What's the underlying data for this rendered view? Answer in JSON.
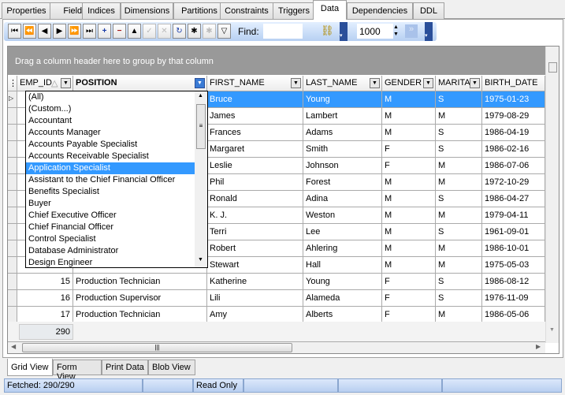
{
  "tabs": [
    "Properties",
    "Fields",
    "Indices",
    "Dimensions",
    "Partitions",
    "Constraints",
    "Triggers",
    "Data",
    "Dependencies",
    "DDL"
  ],
  "active_tab": "Data",
  "toolbar": {
    "find_label": "Find:",
    "find_value": "",
    "record_limit": "1000"
  },
  "group_panel": "Drag a column header here to group by that column",
  "columns": [
    "EMP_ID",
    "POSITION",
    "FIRST_NAME",
    "LAST_NAME",
    "GENDER",
    "MARITAL_STATUS",
    "BIRTH_DATE"
  ],
  "column_headers_shown": [
    "EMP_ID",
    "POSITION",
    "FIRST_NAME",
    "LAST_NAME",
    "GENDER",
    "MARITA",
    "BIRTH_DATE"
  ],
  "rows": [
    [
      "",
      "",
      "Bruce",
      "Young",
      "M",
      "S",
      "1975-01-23"
    ],
    [
      "",
      "",
      "James",
      "Lambert",
      "M",
      "M",
      "1979-08-29"
    ],
    [
      "",
      "",
      "Frances",
      "Adams",
      "M",
      "S",
      "1986-04-19"
    ],
    [
      "",
      "",
      "Margaret",
      "Smith",
      "F",
      "S",
      "1986-02-16"
    ],
    [
      "",
      "",
      "Leslie",
      "Johnson",
      "F",
      "M",
      "1986-07-06"
    ],
    [
      "",
      "",
      "Phil",
      "Forest",
      "M",
      "M",
      "1972-10-29"
    ],
    [
      "",
      "",
      "Ronald",
      "Adina",
      "M",
      "S",
      "1986-04-27"
    ],
    [
      "",
      "",
      "K. J.",
      "Weston",
      "M",
      "M",
      "1979-04-11"
    ],
    [
      "",
      "",
      "Terri",
      "Lee",
      "M",
      "S",
      "1961-09-01"
    ],
    [
      "",
      "",
      "Robert",
      "Ahlering",
      "M",
      "M",
      "1986-10-01"
    ],
    [
      "",
      "",
      "Stewart",
      "Hall",
      "M",
      "M",
      "1975-05-03"
    ],
    [
      "15",
      "Production Technician",
      "Katherine",
      "Young",
      "F",
      "S",
      "1986-08-12"
    ],
    [
      "16",
      "Production Supervisor",
      "Lili",
      "Alameda",
      "F",
      "S",
      "1976-11-09"
    ],
    [
      "17",
      "Production Technician",
      "Amy",
      "Alberts",
      "F",
      "M",
      "1986-05-06"
    ]
  ],
  "footer_count": "290",
  "filter_dropdown": {
    "items": [
      "(All)",
      "(Custom...)",
      "Accountant",
      "Accounts Manager",
      "Accounts Payable Specialist",
      "Accounts Receivable Specialist",
      "Application Specialist",
      "Assistant to the Chief Financial Officer",
      "Benefits Specialist",
      "Buyer",
      "Chief Executive Officer",
      "Chief Financial Officer",
      "Control Specialist",
      "Database Administrator",
      "Design Engineer"
    ],
    "highlighted": "Application Specialist"
  },
  "bottom_tabs": [
    "Grid View",
    "Form View",
    "Print Data",
    "Blob View"
  ],
  "status": {
    "fetched": "Fetched: 290/290",
    "mode": "Read Only"
  },
  "colors": {
    "selection": "#3399ff",
    "group_panel": "#999999"
  }
}
